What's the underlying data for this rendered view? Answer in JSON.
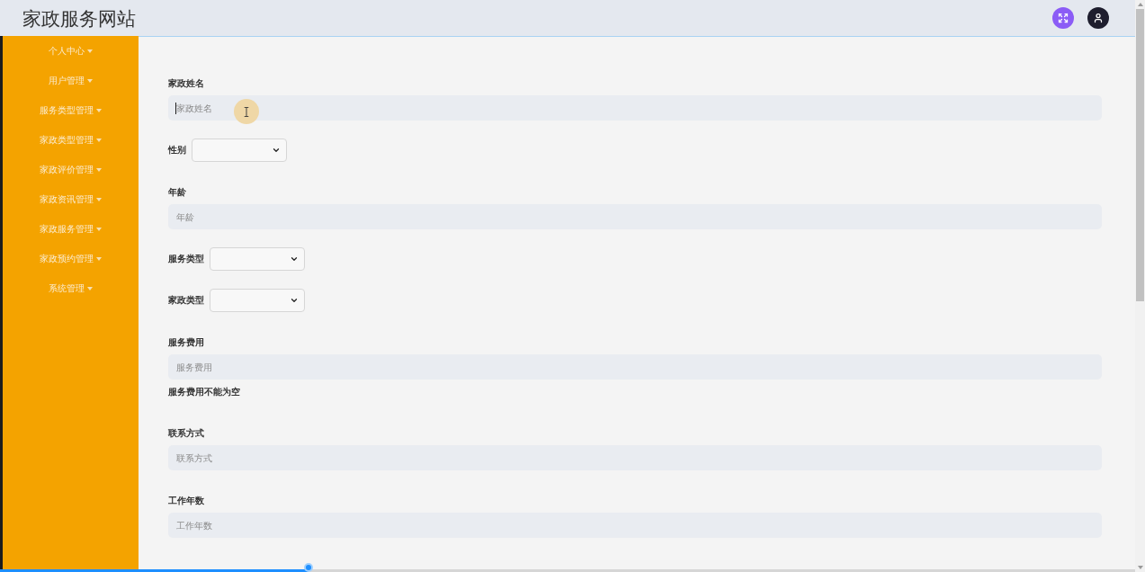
{
  "header": {
    "title": "家政服务网站"
  },
  "sidebar": {
    "items": [
      {
        "label": "个人中心"
      },
      {
        "label": "用户管理"
      },
      {
        "label": "服务类型管理"
      },
      {
        "label": "家政类型管理"
      },
      {
        "label": "家政评价管理"
      },
      {
        "label": "家政资讯管理"
      },
      {
        "label": "家政服务管理"
      },
      {
        "label": "家政预约管理"
      },
      {
        "label": "系统管理"
      }
    ]
  },
  "form": {
    "fields": [
      {
        "kind": "text",
        "label": "家政姓名",
        "placeholder": "家政姓名",
        "focused": true
      },
      {
        "kind": "select",
        "label": "性别",
        "focused": false
      },
      {
        "kind": "text",
        "label": "年龄",
        "placeholder": "年龄",
        "focused": false
      },
      {
        "kind": "select",
        "label": "服务类型",
        "focused": false
      },
      {
        "kind": "select",
        "label": "家政类型",
        "focused": false
      },
      {
        "kind": "text",
        "label": "服务费用",
        "placeholder": "服务费用",
        "focused": false,
        "error": "服务费用不能为空"
      },
      {
        "kind": "text",
        "label": "联系方式",
        "placeholder": "联系方式",
        "focused": false
      },
      {
        "kind": "text",
        "label": "工作年数",
        "placeholder": "工作年数",
        "focused": false
      }
    ]
  },
  "video_progress": {
    "level": 0.272
  }
}
